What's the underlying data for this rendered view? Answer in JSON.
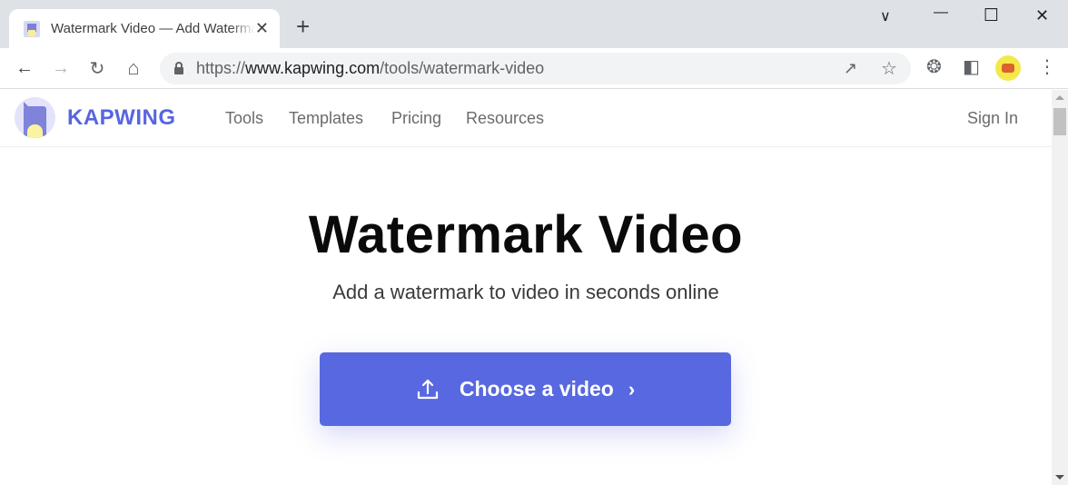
{
  "browser": {
    "tab": {
      "title": "Watermark Video — Add Watermark to Video Online",
      "close": "✕"
    },
    "new_tab": "+",
    "window_controls": {
      "tab_search": "∨",
      "minimize": "—",
      "maximize": "☐",
      "close": "✕"
    },
    "nav": {
      "back": "←",
      "forward": "→",
      "reload": "↻",
      "home": "⌂"
    },
    "url": {
      "scheme": "https://",
      "host": "www.kapwing.com",
      "path": "/tools/watermark-video"
    },
    "icons": {
      "share": "↗",
      "bookmark": "☆",
      "extensions": "❂",
      "side_panel": "◧",
      "menu": "⋮"
    }
  },
  "site": {
    "brand": "KAPWING",
    "nav": [
      {
        "label": "Tools"
      },
      {
        "label": "Templates"
      },
      {
        "label": "Pricing"
      },
      {
        "label": "Resources"
      }
    ],
    "sign_in": "Sign In"
  },
  "hero": {
    "title": "Watermark Video",
    "subtitle": "Add a watermark to video in seconds online",
    "cta_label": "Choose a video",
    "cta_chevron": "›"
  },
  "colors": {
    "brand": "#5865e0",
    "cta": "#5868e0"
  }
}
